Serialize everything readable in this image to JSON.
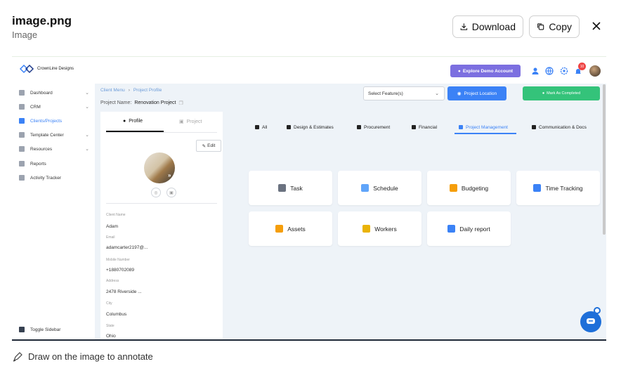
{
  "modal": {
    "title": "image.png",
    "subtitle": "Image",
    "download_label": "Download",
    "copy_label": "Copy",
    "footer_hint": "Draw on the image to annotate"
  },
  "app": {
    "logo_text": "CrownLine Designs",
    "explore_demo_label": "Explore Demo Account",
    "notification_count": "10",
    "sidebar": {
      "items": [
        {
          "label": "Dashboard",
          "icon": "dashboard-icon",
          "chevron": true
        },
        {
          "label": "CRM",
          "icon": "crm-icon",
          "chevron": true
        },
        {
          "label": "Clients/Projects",
          "icon": "clients-icon",
          "chevron": false,
          "active": true
        },
        {
          "label": "Template Center",
          "icon": "template-icon",
          "chevron": true
        },
        {
          "label": "Resources",
          "icon": "resources-icon",
          "chevron": true
        },
        {
          "label": "Reports",
          "icon": "reports-icon",
          "chevron": false
        },
        {
          "label": "Activity Tracker",
          "icon": "activity-icon",
          "chevron": false
        }
      ],
      "toggle_label": "Toggle Sidebar"
    },
    "breadcrumb": {
      "root": "Client Menu",
      "current": "Project Profile"
    },
    "project_name_label": "Project Name:",
    "project_name": "Renovation Project",
    "select_feature_placeholder": "Select Feature(s)",
    "project_location_label": "Project Location",
    "mark_completed_label": "Mark As Completed",
    "profile": {
      "tab_profile": "Profile",
      "tab_project": "Project",
      "edit_label": "Edit",
      "fields": [
        {
          "label": "Client Name",
          "value": "Adam"
        },
        {
          "label": "Email",
          "value": "adamcarter2197@..."
        },
        {
          "label": "Mobile Number",
          "value": "+1880702089"
        },
        {
          "label": "Address",
          "value": "2478 Riverside ..."
        },
        {
          "label": "City",
          "value": "Columbus"
        },
        {
          "label": "State",
          "value": "Ohio"
        }
      ]
    },
    "tabs": [
      {
        "label": "All",
        "icon": "grid-icon"
      },
      {
        "label": "Design & Estimates",
        "icon": "design-icon"
      },
      {
        "label": "Procurement",
        "icon": "procurement-icon"
      },
      {
        "label": "Financial",
        "icon": "financial-icon"
      },
      {
        "label": "Project Management",
        "icon": "project-management-icon",
        "active": true
      },
      {
        "label": "Communication & Docs",
        "icon": "communication-icon"
      }
    ],
    "cards": [
      {
        "label": "Task",
        "icon": "task-icon",
        "color": "#6b7280"
      },
      {
        "label": "Schedule",
        "icon": "schedule-icon",
        "color": "#60a5fa"
      },
      {
        "label": "Budgeting",
        "icon": "budgeting-icon",
        "color": "#f59e0b"
      },
      {
        "label": "Time Tracking",
        "icon": "time-tracking-icon",
        "color": "#3b82f6"
      },
      {
        "label": "Assets",
        "icon": "assets-icon",
        "color": "#f59e0b"
      },
      {
        "label": "Workers",
        "icon": "workers-icon",
        "color": "#eab308"
      },
      {
        "label": "Daily report",
        "icon": "daily-report-icon",
        "color": "#3b82f6"
      }
    ]
  }
}
